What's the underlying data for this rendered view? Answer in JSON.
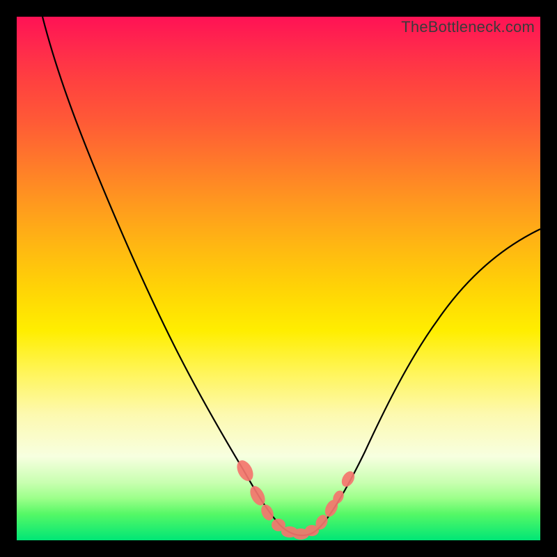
{
  "watermark": "TheBottleneck.com",
  "chart_data": {
    "type": "line",
    "title": "",
    "xlabel": "",
    "ylabel": "",
    "xlim": [
      0,
      100
    ],
    "ylim": [
      0,
      100
    ],
    "grid": false,
    "legend": false,
    "series": [
      {
        "name": "curve-main",
        "color": "#000000",
        "x": [
          5,
          10,
          15,
          20,
          25,
          30,
          35,
          40,
          43,
          46,
          49,
          51,
          53,
          55,
          58,
          62,
          66,
          70,
          75,
          80,
          85,
          90,
          95,
          100
        ],
        "values": [
          100,
          92,
          83,
          74,
          64,
          53,
          42,
          31,
          23,
          15,
          8,
          5,
          3,
          2,
          3,
          6,
          11,
          17,
          25,
          33,
          41,
          48,
          54,
          59
        ]
      },
      {
        "name": "trough-highlight",
        "color": "#f5766e",
        "type": "scatter",
        "x": [
          43,
          46,
          48,
          49,
          50,
          51,
          52,
          53,
          54,
          55,
          57,
          59,
          60
        ],
        "values": [
          21,
          14,
          10,
          8,
          6,
          5,
          4,
          3,
          2,
          2,
          3,
          7,
          9
        ]
      }
    ],
    "background_gradient": {
      "direction": "top-to-bottom",
      "stops": [
        {
          "pct": 0,
          "color": "#ff1255"
        },
        {
          "pct": 50,
          "color": "#ffd406"
        },
        {
          "pct": 80,
          "color": "#fdf9b0"
        },
        {
          "pct": 100,
          "color": "#00e676"
        }
      ]
    }
  }
}
